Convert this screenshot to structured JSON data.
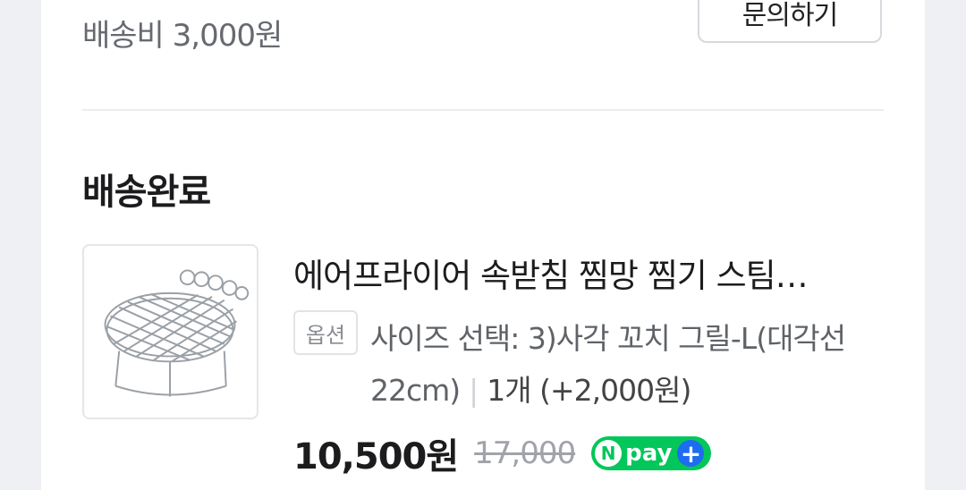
{
  "shipping": {
    "fee_label": "배송비 3,000원"
  },
  "inquiry": {
    "label": "문의하기"
  },
  "order": {
    "status": "배송완료",
    "product": {
      "name": "에어프라이어 속받침 찜망 찜기 스팀…",
      "option_badge": "옵션",
      "option_text": "사이즈 선택: 3)사각 꼬치 그릴-L(대각선 22cm)",
      "separator": "|",
      "quantity_text": "1개 (+2,000원)",
      "price": "10,500원",
      "original_price": "17,000",
      "npay": {
        "n": "N",
        "pay": "pay",
        "plus": "+"
      }
    }
  },
  "colors": {
    "npay_green": "#03c75a",
    "npay_plus_blue": "#1e6cf0",
    "background": "#eef0f3",
    "card": "#ffffff"
  }
}
